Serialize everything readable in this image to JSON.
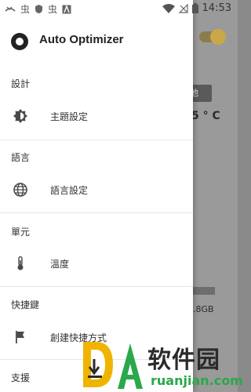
{
  "status_bar": {
    "time": "14:53",
    "left_icons": [
      "missed-call-icon",
      "bug-icon",
      "shield-icon",
      "bug-icon",
      "notification-a-icon"
    ],
    "right_icons": [
      "wifi-icon",
      "no-signal-icon",
      "battery-icon"
    ]
  },
  "drawer": {
    "app_title": "Auto Optimizer",
    "sections": [
      {
        "label": "設計",
        "items": [
          {
            "label": "主題設定",
            "icon": "brightness-icon"
          }
        ]
      },
      {
        "label": "語言",
        "items": [
          {
            "label": "語言設定",
            "icon": "globe-icon"
          }
        ]
      },
      {
        "label": "單元",
        "items": [
          {
            "label": "溫度",
            "icon": "thermometer-icon"
          }
        ]
      },
      {
        "label": "快捷鍵",
        "items": [
          {
            "label": "創建快捷方式",
            "icon": "flag-icon"
          }
        ]
      },
      {
        "label": "支援",
        "items": []
      }
    ]
  },
  "background_app": {
    "chip_text": "池",
    "temp_text": "5 ° C",
    "storage_text": ".8GB"
  },
  "watermark": {
    "cn_text": "软件园",
    "domain": "ruanjian.com"
  }
}
